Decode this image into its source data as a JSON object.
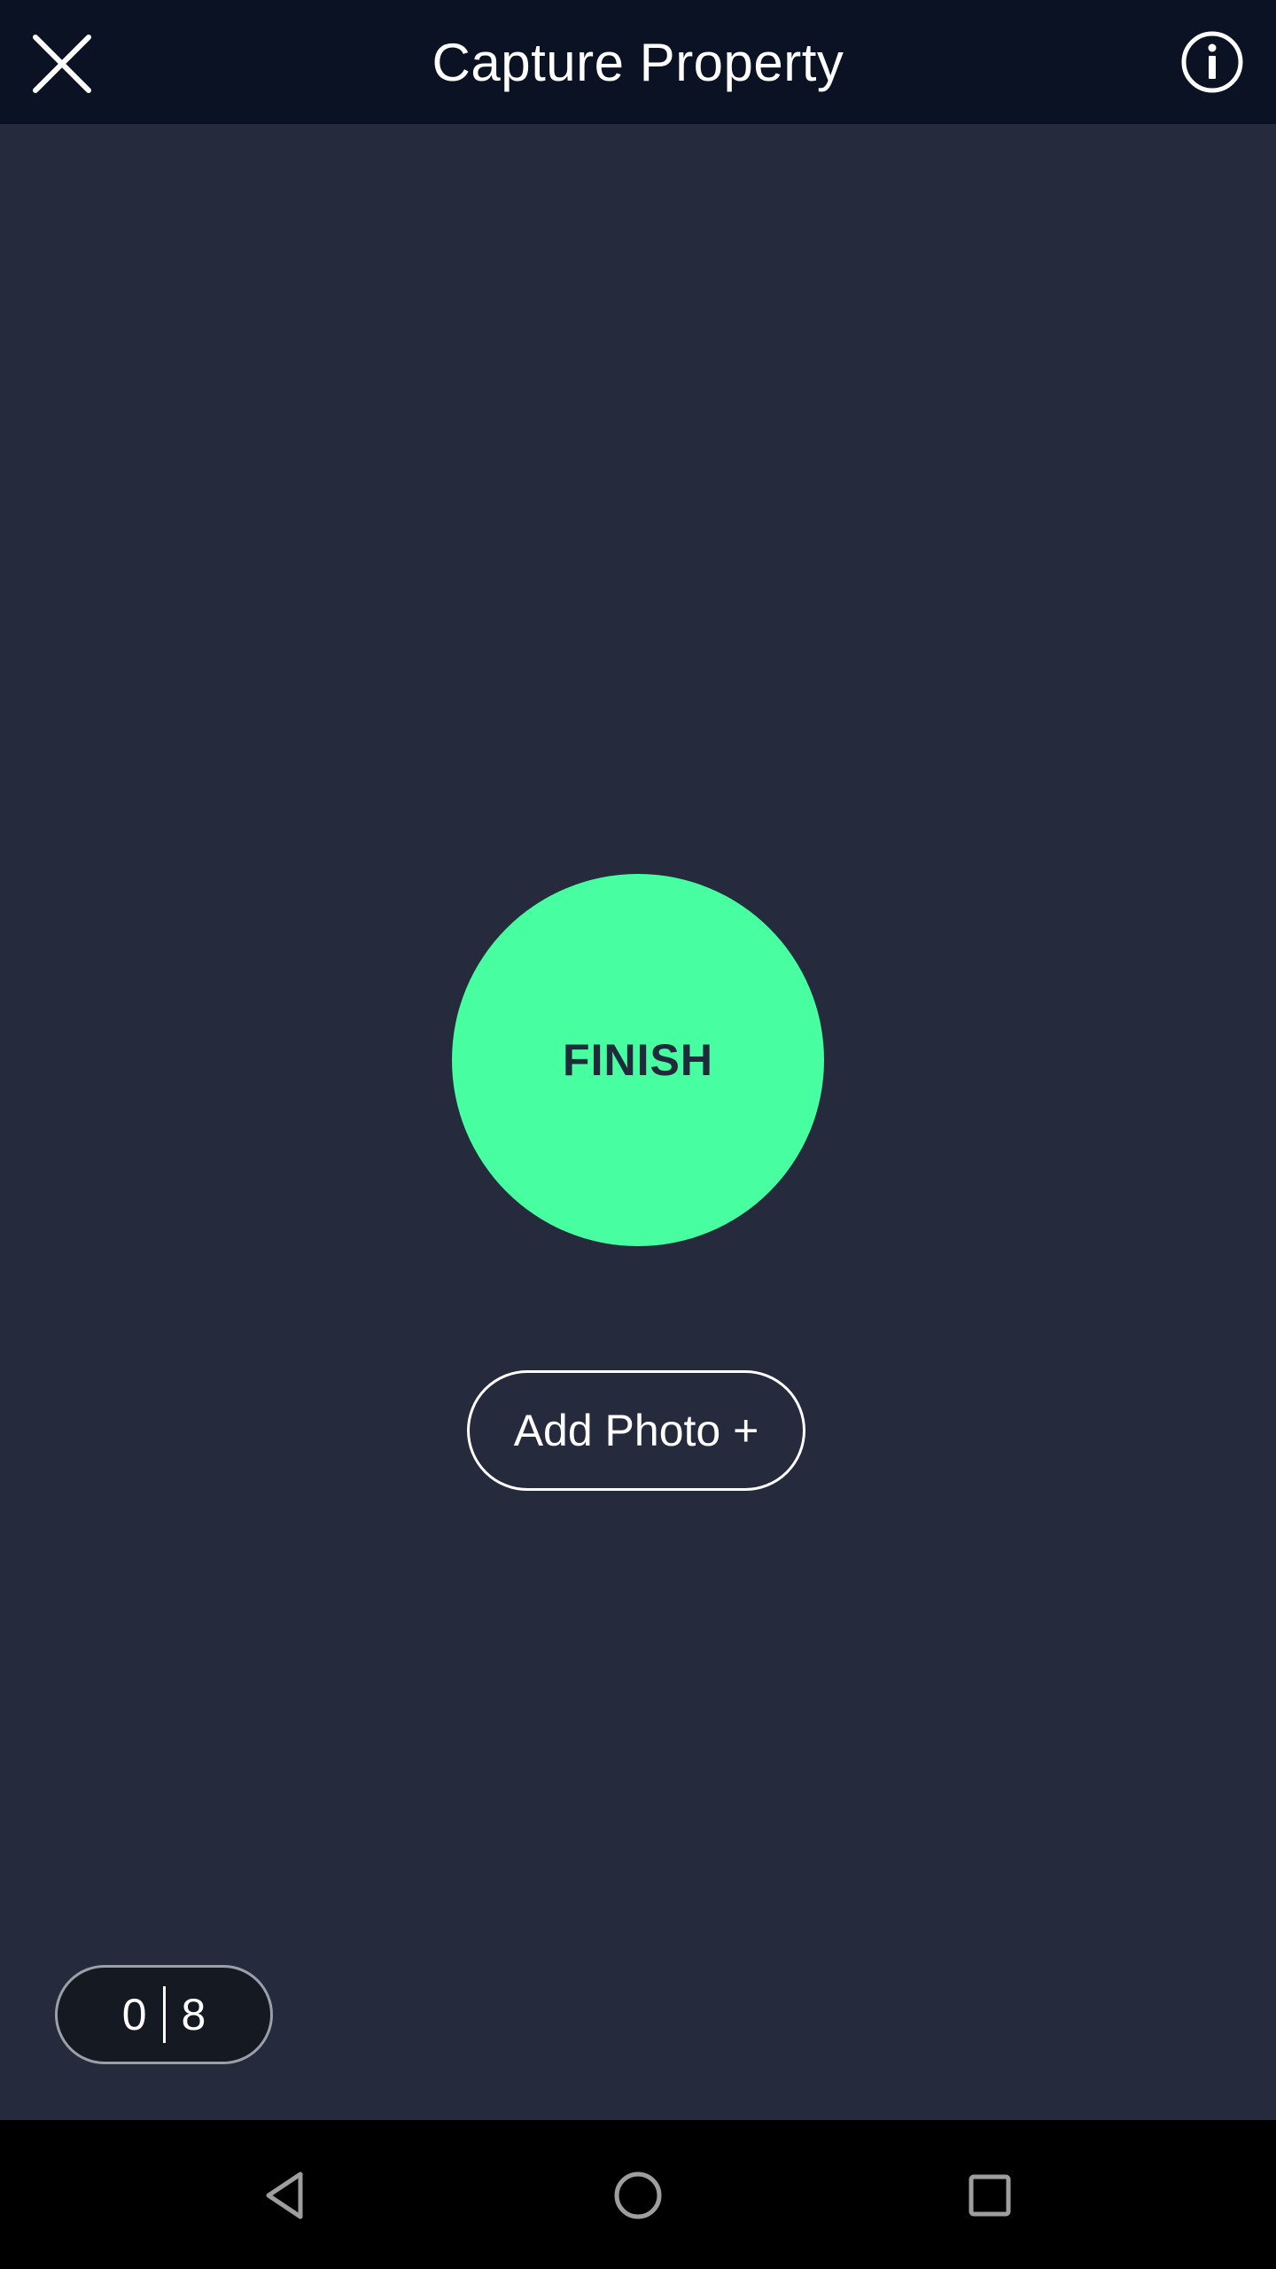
{
  "header": {
    "title": "Capture Property",
    "close_icon": "close-icon",
    "info_icon": "info-icon"
  },
  "main": {
    "finish_label": "FINISH",
    "add_photo_label": "Add Photo +",
    "photo_counter": {
      "current": "0",
      "total": "8"
    }
  },
  "navbar": {
    "back_icon": "back-triangle-icon",
    "home_icon": "home-circle-icon",
    "recents_icon": "recents-square-icon"
  },
  "colors": {
    "header_bg": "#0b1224",
    "main_bg": "#252a3c",
    "finish_accent": "#47fea0",
    "finish_text": "#1f2a3a",
    "nav_bg": "#000000"
  }
}
